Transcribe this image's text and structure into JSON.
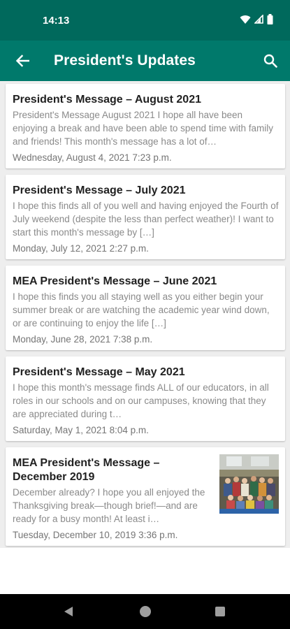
{
  "status_bar": {
    "time": "14:13"
  },
  "app_bar": {
    "title": "President's Updates"
  },
  "posts": [
    {
      "title": "President's Message – August 2021",
      "excerpt": "President's Message August 2021  I hope all have been enjoying a break and have been able to spend time with family and friends!  This month's message has a lot of…",
      "date": "Wednesday, August 4, 2021 7:23 p.m."
    },
    {
      "title": "President's Message – July 2021",
      "excerpt": "I hope this finds all of you well and having enjoyed the Fourth of July weekend (despite the less than perfect weather)! I want to start this month's message by […]",
      "date": "Monday, July 12, 2021 2:27 p.m."
    },
    {
      "title": "MEA President's Message – June 2021",
      "excerpt": "I hope this finds you all staying well as you either begin your summer break or are watching the academic year wind down, or are continuing to enjoy the life […]",
      "date": "Monday, June 28, 2021 7:38 p.m."
    },
    {
      "title": "President's Message – May 2021",
      "excerpt": "I hope this month's message finds ALL of our educators, in all roles in our schools and on our campuses, knowing that they are appreciated during t…",
      "date": "Saturday, May 1, 2021 8:04 p.m."
    },
    {
      "title": "MEA President's Message – December 2019",
      "excerpt": "December already? I hope you all enjoyed the Thanksgiving break—though brief!—and are ready for a busy month! At least i…",
      "date": "Tuesday, December 10, 2019 3:36 p.m."
    }
  ],
  "icons": {
    "back": "arrow-back-icon",
    "search": "search-icon",
    "wifi": "wifi-icon",
    "signal": "signal-icon",
    "battery": "battery-icon",
    "nav_back": "nav-back-icon",
    "nav_home": "nav-home-icon",
    "nav_recents": "nav-recents-icon"
  },
  "colors": {
    "status_bar": "#00695c",
    "app_bar": "#00796b",
    "background": "#eeeeee",
    "title_text": "#212121",
    "excerpt_text": "#8a8a8a"
  }
}
